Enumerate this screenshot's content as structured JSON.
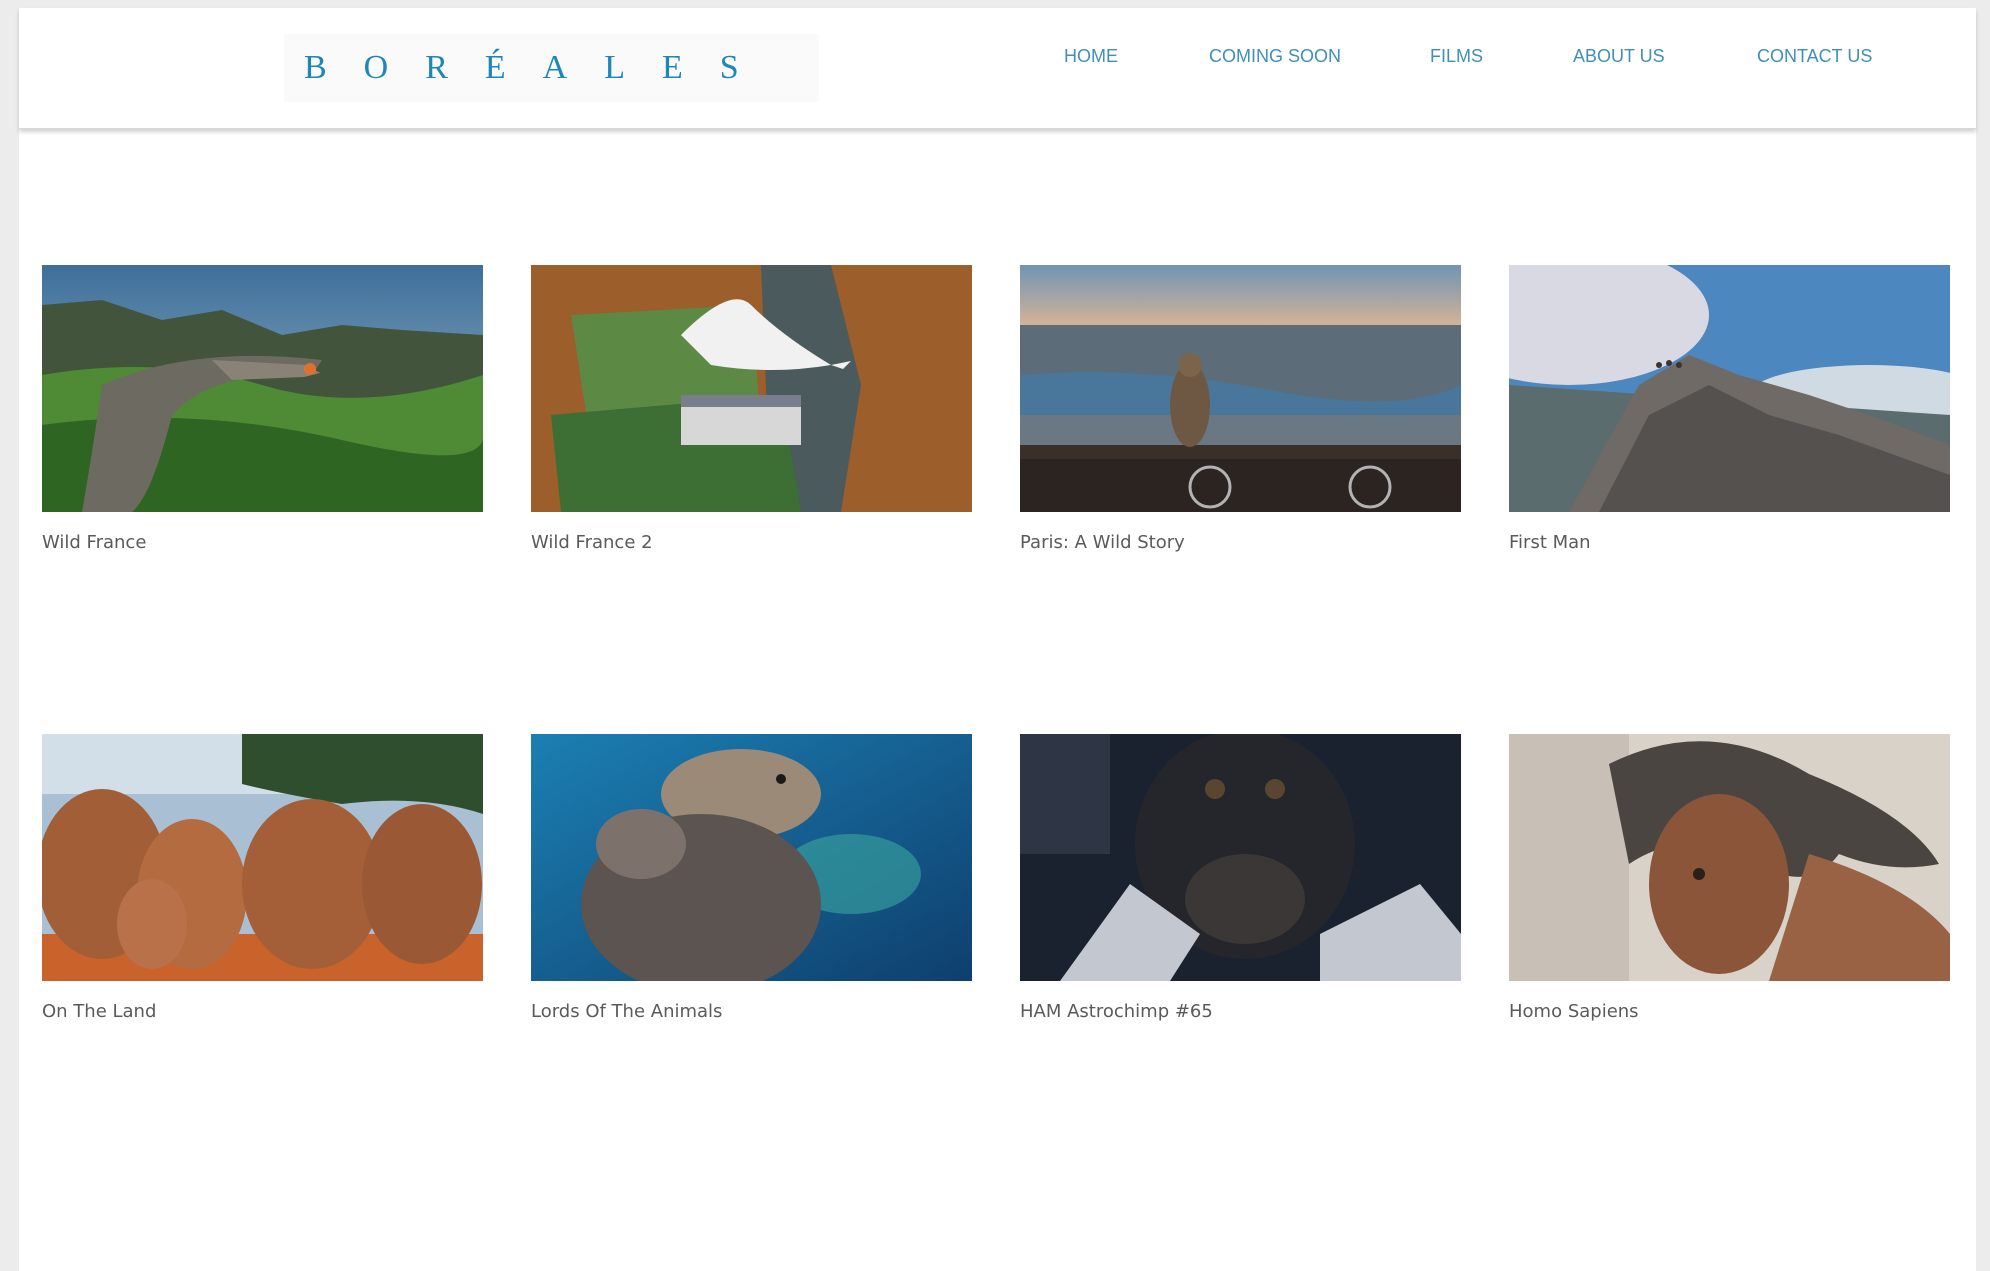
{
  "site": {
    "logo_text": "BORÉALES"
  },
  "nav": {
    "home": "HOME",
    "coming_soon": "COMING SOON",
    "films": "FILMS",
    "about_us": "ABOUT US",
    "contact_us": "CONTACT US"
  },
  "films": [
    {
      "title": "Wild France"
    },
    {
      "title": "Wild France 2"
    },
    {
      "title": "Paris: A Wild Story"
    },
    {
      "title": "First Man"
    },
    {
      "title": "On The Land"
    },
    {
      "title": "Lords Of The Animals"
    },
    {
      "title": "HAM Astrochimp #65"
    },
    {
      "title": "Homo Sapiens"
    }
  ],
  "colors": {
    "brand": "#1f86b8",
    "nav": "#3f8fb8",
    "caption": "#5a5a5a"
  }
}
